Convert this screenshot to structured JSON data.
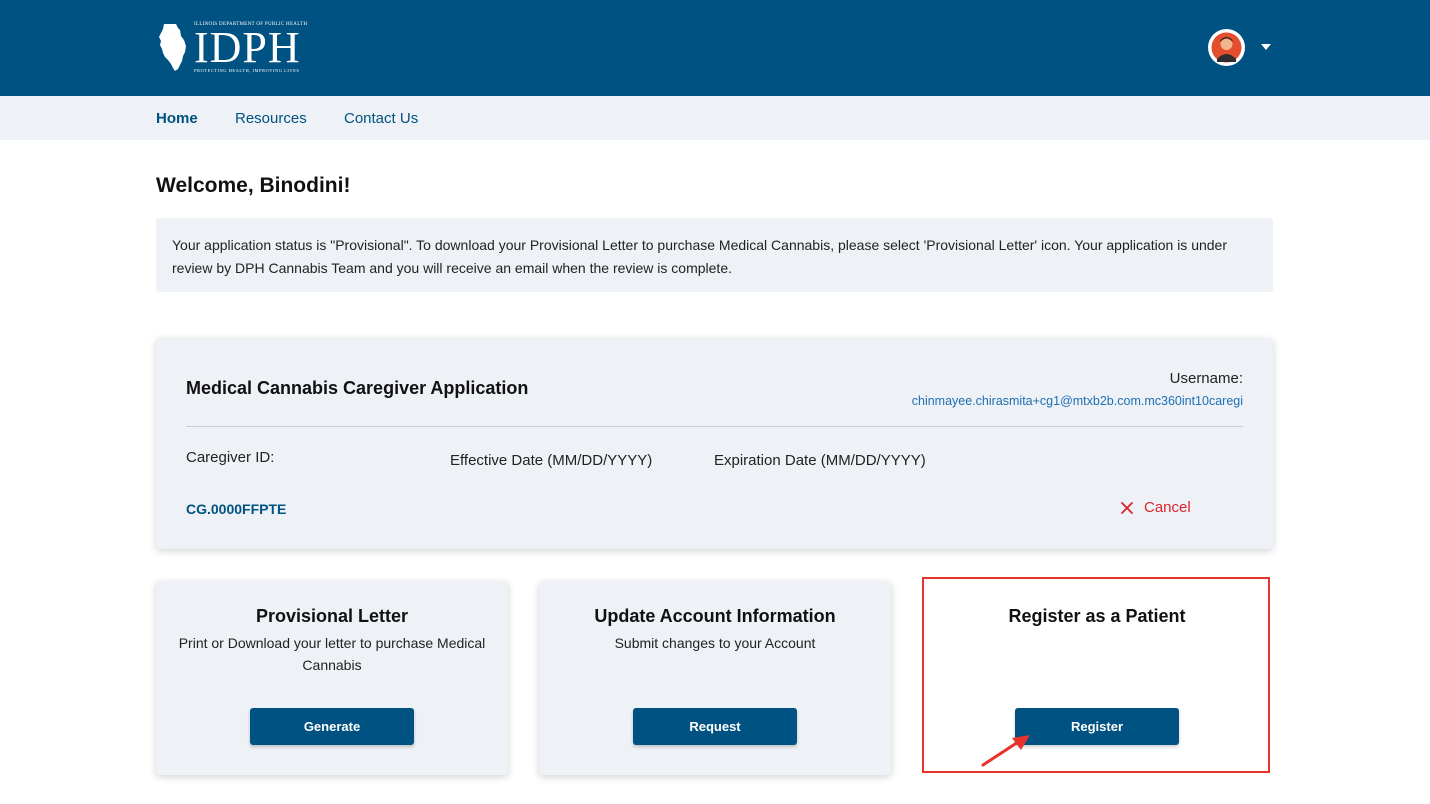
{
  "header": {
    "logo": {
      "top_text": "ILLINOIS DEPARTMENT OF PUBLIC HEALTH",
      "main_text": "IDPH",
      "tagline": "PROTECTING HEALTH, IMPROVING LIVES"
    }
  },
  "nav": {
    "items": [
      {
        "label": "Home"
      },
      {
        "label": "Resources"
      },
      {
        "label": "Contact Us"
      }
    ]
  },
  "welcome": "Welcome, Binodini!",
  "notice": "Your application status is \"Provisional\". To download your Provisional Letter to purchase Medical Cannabis, please select 'Provisional Letter' icon. Your application is under review by DPH Cannabis Team and you will receive an email when the review is complete.",
  "application": {
    "title": "Medical Cannabis Caregiver Application",
    "username_label": "Username:",
    "username_value": "chinmayee.chirasmita+cg1@mtxb2b.com.mc360int10caregi",
    "caregiver_id_label": "Caregiver ID:",
    "effective_date_label": "Effective Date (MM/DD/YYYY)",
    "expiration_date_label": "Expiration Date (MM/DD/YYYY)",
    "caregiver_id_value": "CG.0000FFPTE",
    "cancel_label": "Cancel"
  },
  "tiles": [
    {
      "title": "Provisional Letter",
      "description": "Print or Download your letter to purchase Medical Cannabis",
      "button": "Generate"
    },
    {
      "title": "Update Account Information",
      "description": "Submit changes to your Account",
      "button": "Request"
    },
    {
      "title": "Register as a Patient",
      "description": "",
      "button": "Register"
    }
  ],
  "colors": {
    "brand_blue": "#005282",
    "panel_gray": "#eef1f5",
    "link_blue": "#1f6fb5",
    "cancel_red": "#d9262c",
    "annotation_red": "#e8332a"
  },
  "icons": {
    "logo": "illinois-state-icon",
    "avatar": "user-avatar",
    "dropdown": "caret-down-icon",
    "cancel": "close-icon",
    "annotation": "arrow-annotation"
  }
}
